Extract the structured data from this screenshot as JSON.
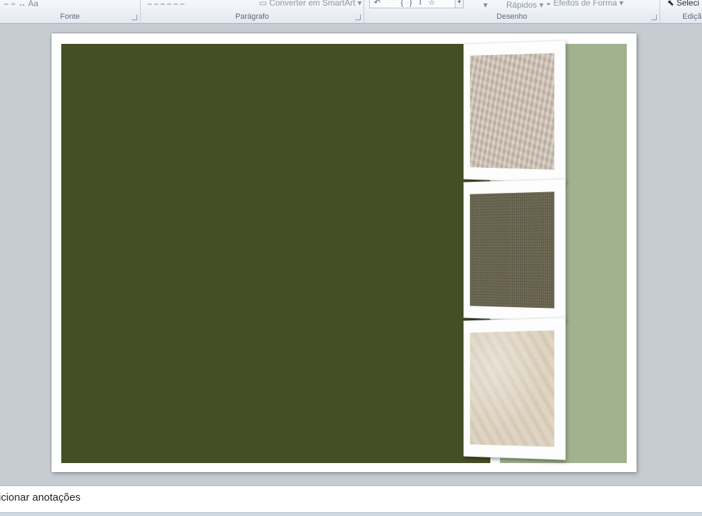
{
  "ribbon": {
    "groups": [
      {
        "id": "fonte",
        "label": "Fonte"
      },
      {
        "id": "paragrafo",
        "label": "Parágrafo"
      },
      {
        "id": "desenho",
        "label": "Desenho"
      },
      {
        "id": "edicao",
        "label": "Ediçã"
      }
    ],
    "convert_smartart": "Converter em SmartArt",
    "quick_styles": "Rápidos",
    "shape_effects": "Efeitos de Forma",
    "select": "Seleci",
    "shapes_gallery_glyphs": "↶ ⌒ { } ⌇ ☆"
  },
  "slide": {
    "main_panel_color": "#464e24",
    "side_panel_color": "#a2b18e",
    "photos": [
      {
        "name": "beige-crumpled-texture"
      },
      {
        "name": "dark-olive-linen-texture"
      },
      {
        "name": "cream-marble-texture"
      }
    ]
  },
  "notes": {
    "placeholder": "icionar anotações"
  }
}
